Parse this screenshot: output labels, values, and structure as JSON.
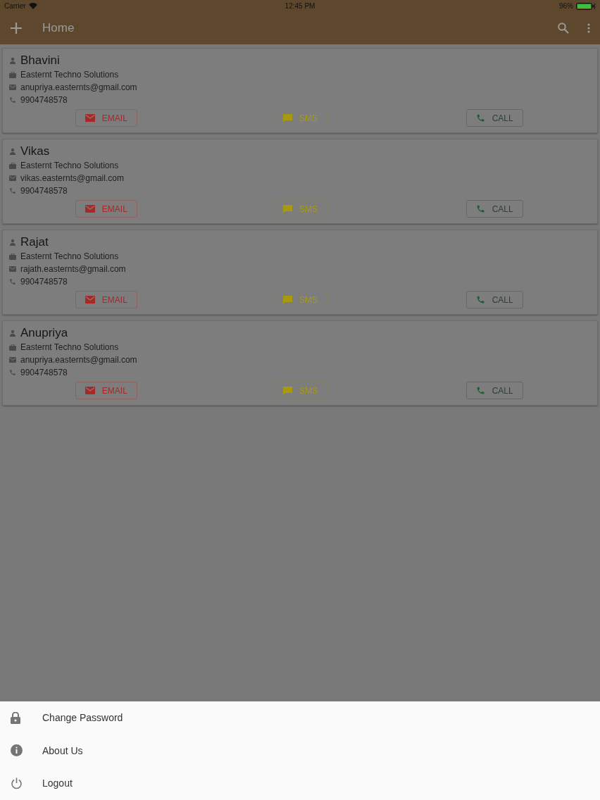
{
  "status_bar": {
    "carrier": "Carrier",
    "time": "12:45 PM",
    "battery": "96%"
  },
  "toolbar": {
    "title": "Home"
  },
  "contacts": [
    {
      "name": "Bhavini",
      "company": "Easternt Techno Solutions",
      "email": "anupriya.easternts@gmail.com",
      "phone": "9904748578",
      "actions": [
        {
          "kind": "email",
          "label": "EMAIL"
        },
        {
          "kind": "sms",
          "label": "SMS"
        },
        {
          "kind": "call",
          "label": "CALL"
        }
      ]
    },
    {
      "name": "Vikas",
      "company": "Easternt Techno Solutions",
      "email": "vikas.easternts@gmail.com",
      "phone": "9904748578",
      "actions": [
        {
          "kind": "email",
          "label": "EMAIL"
        },
        {
          "kind": "sms",
          "label": "SMS"
        },
        {
          "kind": "call",
          "label": "CALL"
        }
      ]
    },
    {
      "name": "Rajat",
      "company": "Easternt Techno Solutions",
      "email": "rajath.easternts@gmail.com",
      "phone": "9904748578",
      "actions": [
        {
          "kind": "email",
          "label": "EMAIL"
        },
        {
          "kind": "sms",
          "label": "SMS"
        },
        {
          "kind": "call",
          "label": "CALL"
        }
      ]
    },
    {
      "name": "Anupriya",
      "company": "Easternt Techno Solutions",
      "email": "anupriya.easternts@gmail.com",
      "phone": "9904748578",
      "actions": [
        {
          "kind": "email",
          "label": "EMAIL"
        },
        {
          "kind": "sms",
          "label": "SMS"
        },
        {
          "kind": "call",
          "label": "CALL"
        }
      ]
    }
  ],
  "menu": [
    {
      "kind": "lock",
      "label": "Change Password"
    },
    {
      "kind": "info",
      "label": "About Us"
    },
    {
      "kind": "power",
      "label": "Logout"
    }
  ]
}
